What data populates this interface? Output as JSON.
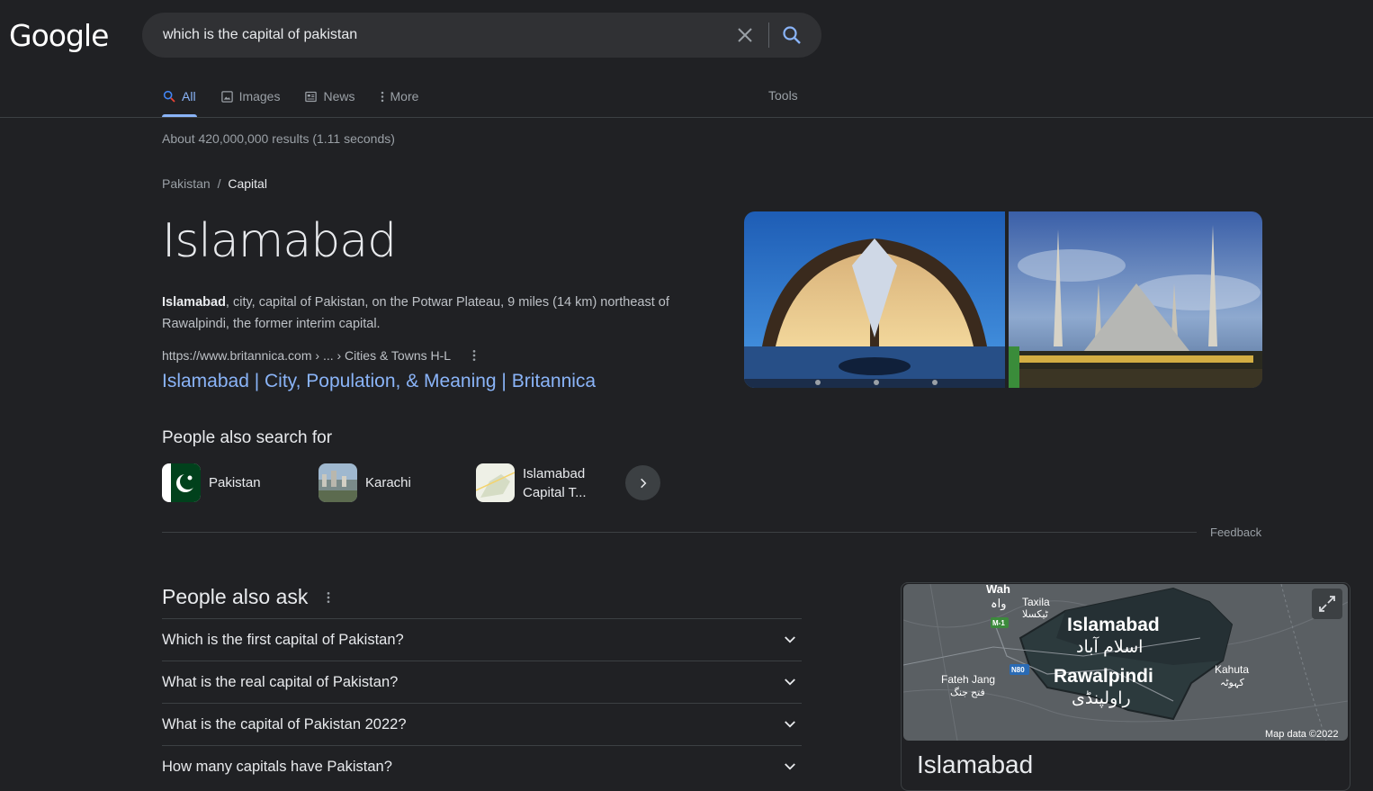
{
  "header": {
    "logo": "Google",
    "search_query": "which is the capital of pakistan"
  },
  "tabs": [
    {
      "label": "All",
      "icon": "search-icon",
      "active": true
    },
    {
      "label": "Images",
      "icon": "image-icon",
      "active": false
    },
    {
      "label": "News",
      "icon": "news-icon",
      "active": false
    },
    {
      "label": "More",
      "icon": "more-vert-icon",
      "active": false
    }
  ],
  "tools_label": "Tools",
  "result_stats": "About 420,000,000 results (1.11 seconds)",
  "breadcrumb": {
    "parent": "Pakistan",
    "separator": "/",
    "current": "Capital"
  },
  "answer": {
    "title": "Islamabad",
    "desc_bold": "Islamabad",
    "desc_rest": ", city, capital of Pakistan, on the Potwar Plateau, 9 miles (14 km) northeast of Rawalpindi, the former interim capital.",
    "source_url": "https://www.britannica.com › ... › Cities & Towns H-L",
    "source_title": "Islamabad | City, Population, & Meaning | Britannica"
  },
  "people_also_search": {
    "title": "People also search for",
    "items": [
      {
        "label": "Pakistan",
        "icon": "pakistan-flag-icon"
      },
      {
        "label": "Karachi",
        "icon": "karachi-photo"
      },
      {
        "label": "Islamabad Capital T...",
        "icon": "map-thumbnail"
      }
    ]
  },
  "feedback_label": "Feedback",
  "people_also_ask": {
    "title": "People also ask",
    "questions": [
      "Which is the first capital of Pakistan?",
      "What is the real capital of Pakistan?",
      "What is the capital of Pakistan 2022?",
      "How many capitals have Pakistan?"
    ]
  },
  "map": {
    "labels": {
      "wah": "Wah",
      "wah_urdu": "واہ",
      "taxila": "Taxila",
      "taxila_urdu": "ٹیکسلا",
      "islamabad": "Islamabad",
      "islamabad_urdu": "اسلام آباد",
      "rawalpindi": "Rawalpindi",
      "rawalpindi_urdu": "راولپنڈی",
      "fateh_jang": "Fateh Jang",
      "fateh_jang_urdu": "فتح جنگ",
      "kahuta": "Kahuta",
      "kahuta_urdu": "کہوٹہ",
      "m1": "M-1",
      "n80": "N80"
    },
    "attribution": "Map data ©2022",
    "card_title": "Islamabad"
  },
  "colors": {
    "background": "#202124",
    "link": "#8ab4f8",
    "text": "#e8eaed",
    "muted": "#9aa0a6"
  }
}
